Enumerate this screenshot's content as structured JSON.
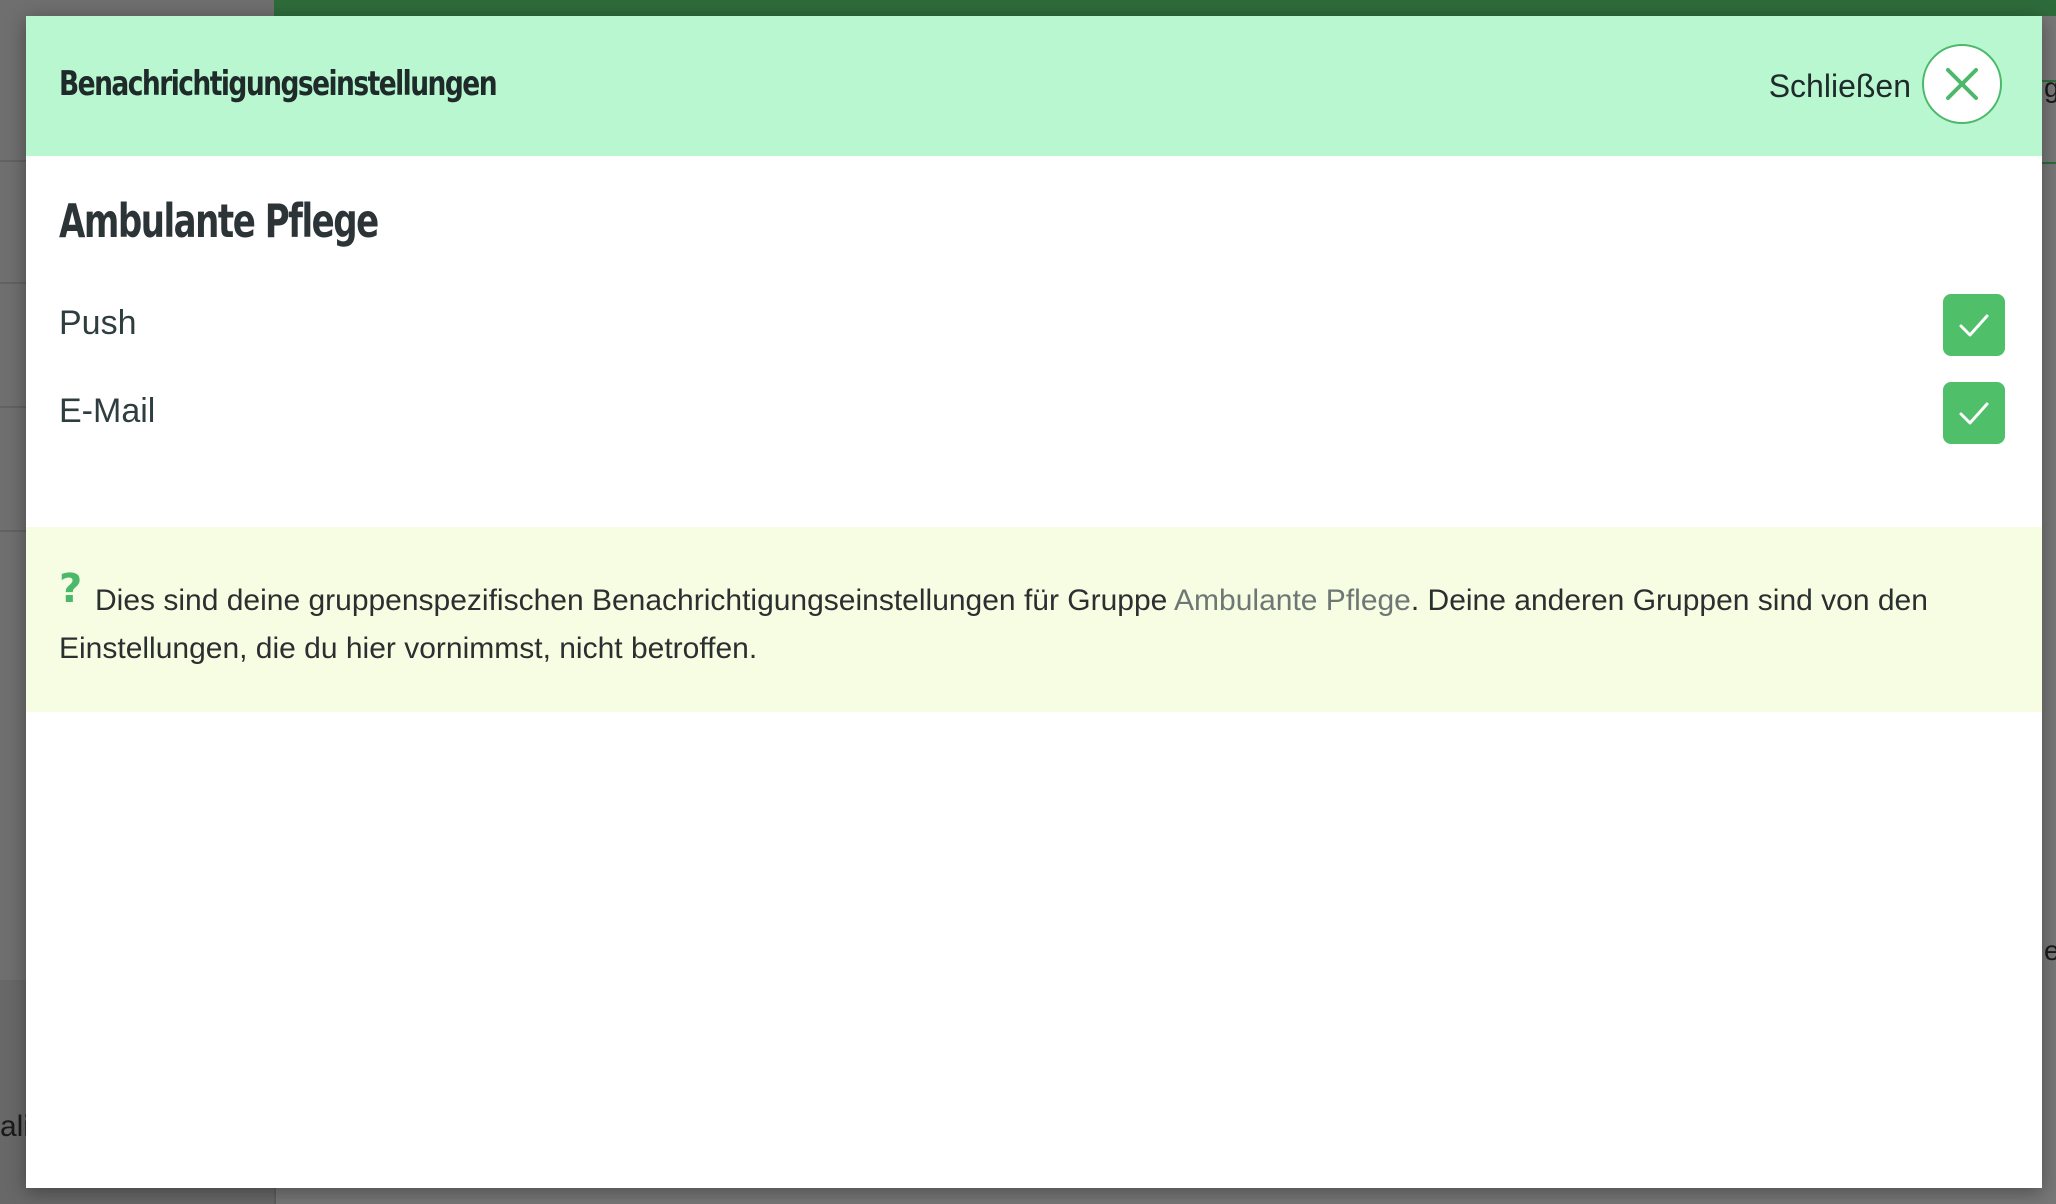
{
  "background": {
    "sidebar_fragment": "ali",
    "right_fragment_top": "g",
    "right_fragment_mid": "es"
  },
  "modal": {
    "title": "Benachrichtigungseinstellungen",
    "close_label": "Schließen",
    "close_icon": "close-icon"
  },
  "group": {
    "name": "Ambulante Pflege",
    "options": [
      {
        "label": "Push",
        "checked": true
      },
      {
        "label": "E-Mail",
        "checked": true
      }
    ]
  },
  "info": {
    "icon_glyph": "?",
    "text_before": "Dies sind deine gruppenspezifischen Benachrichtigungseinstellungen für Gruppe ",
    "link_text": "Ambulante Pflege",
    "text_after": ". Deine anderen Gruppen sind von den Einstellungen, die du hier vornimmst, nicht betroffen."
  },
  "colors": {
    "header_bg": "#b8f7d0",
    "accent": "#4fbf6a",
    "info_bg": "#f6fde2",
    "topbar": "#2e6b3a"
  }
}
